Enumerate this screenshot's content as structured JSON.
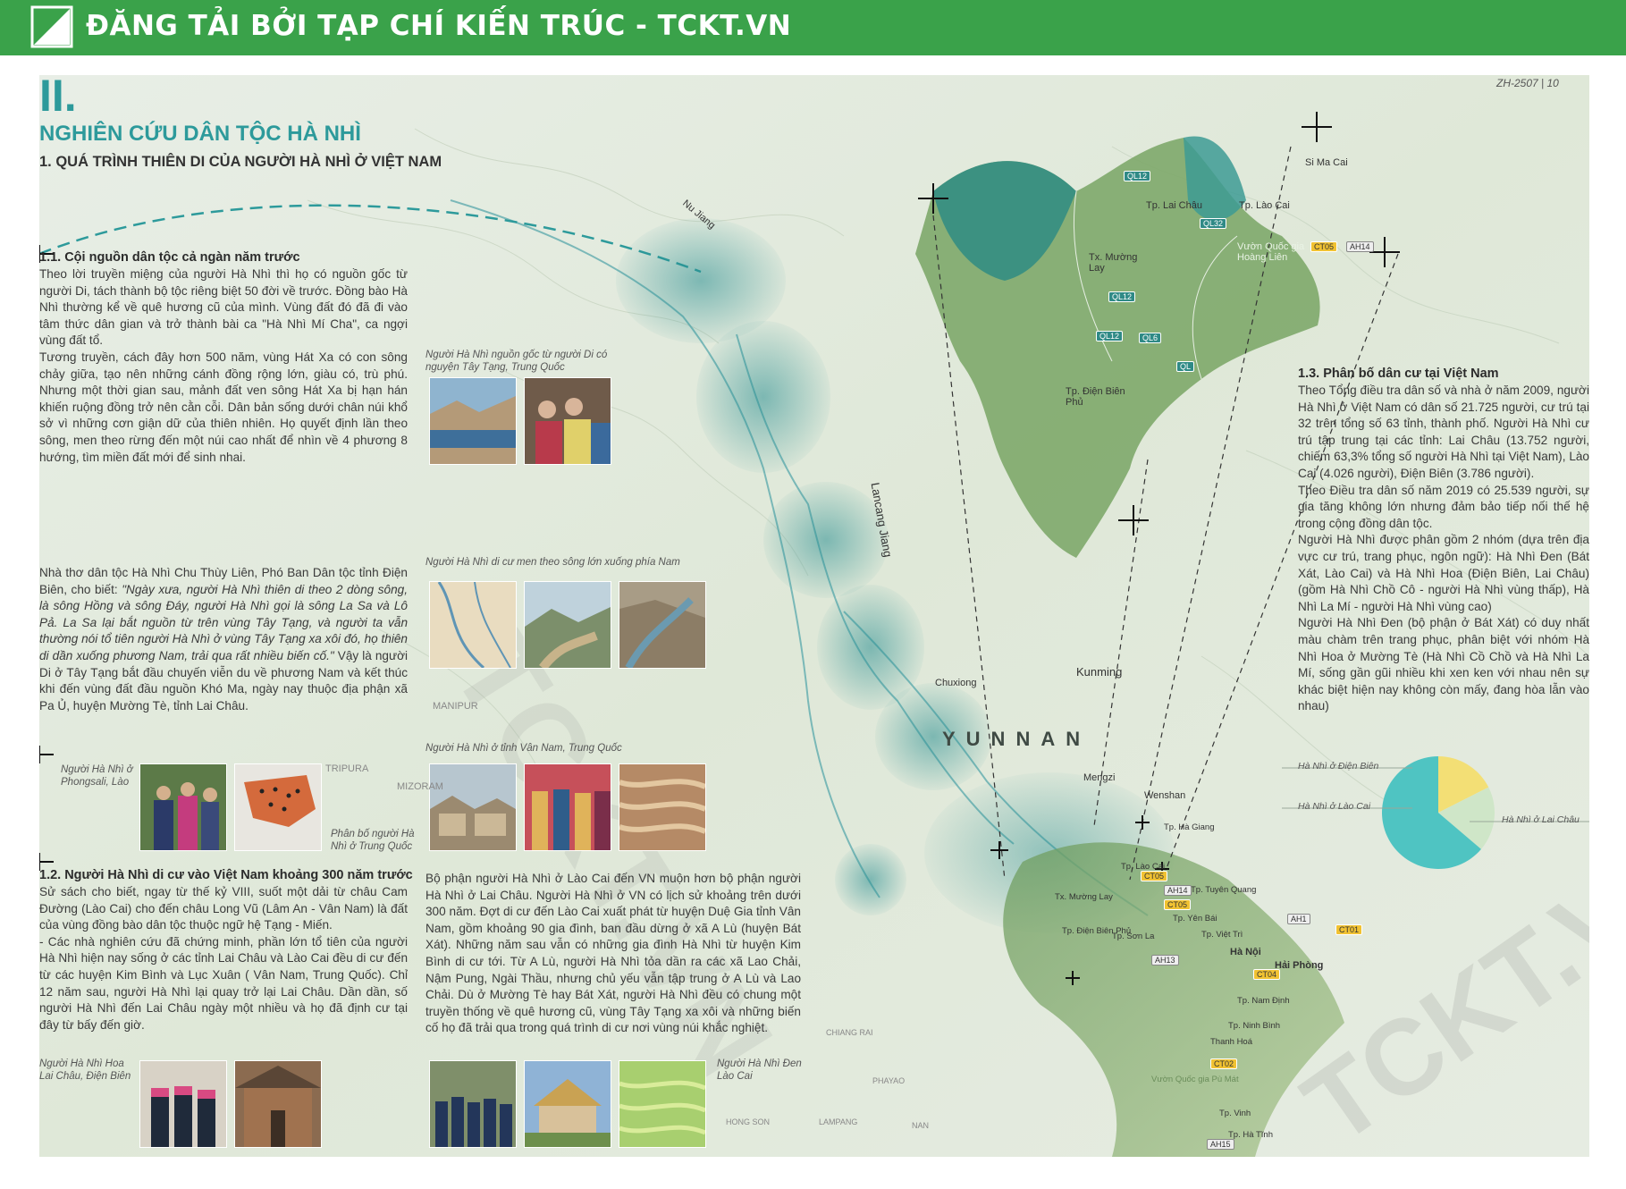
{
  "banner": {
    "title": "ĐĂNG TẢI BỞI TẠP CHÍ KIẾN TRÚC - TCKT.VN",
    "color": "#3aa24a"
  },
  "page_code": "ZH-2507 | 10",
  "section": {
    "number": "II.",
    "title": "NGHIÊN CỨU DÂN TỘC HÀ NHÌ",
    "subtitle": "1. QUÁ TRÌNH THIÊN DI CỦA NGƯỜI HÀ NHÌ Ở VIỆT NAM"
  },
  "s11": {
    "heading": "1.1. Cội nguồn dân tộc cả ngàn năm trước",
    "para1": "Theo lời truyền miệng của người Hà Nhì thì họ có nguồn gốc từ người Di, tách thành bộ tộc riêng biệt 50 đời về trước. Đồng bào Hà Nhì thường kể về quê hương cũ của mình. Vùng đất đó đã đi vào tâm thức dân gian và trở thành bài ca \"Hà Nhì Mí Cha\", ca ngợi vùng đất tổ.",
    "para2": "Tương truyền, cách đây hơn 500 năm, vùng Hát Xa có con sông chảy giữa, tạo nên những cánh đồng rộng lớn, giàu có, trù phú. Nhưng một thời gian sau, mảnh đất ven sông Hát Xa bị hạn hán khiến ruộng đồng trở nên cằn cỗi. Dân bản sống dưới chân núi khổ sở vì những cơn giận dữ của thiên nhiên. Họ quyết định lần theo sông, men theo rừng đến một núi cao nhất để nhìn về 4 phương 8 hướng, tìm miền đất mới để sinh nhai.",
    "para3a": "Nhà thơ dân tộc Hà Nhì Chu Thùy Liên, Phó Ban Dân tộc tỉnh Điện Biên, cho biết: ",
    "para3quote": "\"Ngày xưa, người Hà Nhì thiên di theo 2 dòng sông, là sông Hồng và sông Đáy, người Hà Nhì gọi là sông La Sa và Lô Pả. La Sa lại bắt nguồn từ trên vùng Tây Tạng, và người ta vẫn thường nói tổ tiên người Hà Nhì ở vùng Tây Tạng xa xôi đó, họ thiên di dần xuống phương Nam, trải qua rất nhiều biến cố.\"",
    "para3b": "Vậy là người Di ở Tây Tạng bắt đầu chuyến viễn du về phương Nam và kết thúc khi đến vùng đất đầu nguồn Khó Ma, ngày nay thuộc địa phận xã Pa Ủ, huyện Mường Tè, tỉnh Lai Châu."
  },
  "s12": {
    "heading": "1.2. Người Hà Nhì di cư vào Việt Nam khoảng 300 năm trước",
    "para1": "Sử sách cho biết, ngay từ thế kỷ VIII, suốt một dải từ châu Cam Đường (Lào Cai) cho đến châu Long Vũ (Lâm An - Vân Nam) là đất của vùng đồng bào dân tộc thuộc ngữ hệ Tạng - Miến.",
    "para2": "- Các nhà nghiên cứu đã chứng minh, phần lớn tổ tiên của người Hà Nhì hiện nay sống ở các tỉnh Lai Châu và Lào Cai đều di cư đến từ các huyện Kim Bình và Lục Xuân ( Vân Nam, Trung Quốc). Chỉ 12 năm sau, người Hà Nhì lại quay trở lại Lai Châu. Dần dần, số người Hà Nhì đến Lai Châu ngày một nhiều và họ đã định cư tại đây từ bấy đến giờ.",
    "para3": "Bộ phận người Hà Nhì ở Lào Cai đến VN muộn hơn bộ phận người Hà Nhì ở Lai Châu. Người Hà Nhì ở VN có lịch sử khoảng trên dưới 300 năm. Đợt di cư đến Lào Cai xuất phát từ huyện Duệ Gia tỉnh Vân Nam, gồm khoảng 90 gia đình, ban đầu dừng ở xã A Lù (huyện Bát Xát). Những năm sau vẫn có những gia đình Hà Nhì từ huyện Kim Bình di cư tới. Từ A Lù, người Hà Nhì tỏa dần ra các xã Lao Chải, Nậm Pung, Ngài Thầu, nhưng chủ yếu vẫn tập trung ở A Lù và Lao Chải. Dù ở Mường Tè hay Bát Xát, người Hà Nhì đều có chung một truyền thống về quê hương cũ, vùng Tây Tạng xa xôi và những biến cố họ đã trải qua trong quá trình di cư nơi vùng núi khắc nghiệt."
  },
  "s13": {
    "heading": "1.3. Phân bố dân cư tại Việt Nam",
    "para1": "Theo Tổng điều tra dân số và nhà ở năm 2009, người Hà Nhì ở Việt Nam có dân số 21.725 người, cư trú tại 32 trên tổng số 63 tỉnh, thành phố. Người Hà Nhì cư trú tập trung tại các tỉnh: Lai Châu (13.752 người, chiếm 63,3% tổng số người Hà Nhì tại Việt Nam), Lào Cai (4.026 người), Điện Biên (3.786 người).",
    "para2": "Theo Điều tra dân số năm 2019 có 25.539 người, sự gia tăng không lớn nhưng đảm bảo tiếp nối thế hệ trong cộng đồng dân tộc.",
    "para3": "Người Hà Nhì được phân gồm 2 nhóm (dựa trên địa vực cư trú, trang phục, ngôn ngữ): Hà Nhì Đen (Bát Xát, Lào Cai) và Hà Nhì Hoa (Điện Biên, Lai Châu) (gồm Hà Nhì Chồ Cô - người Hà Nhì vùng thấp), Hà Nhì La Mí - người Hà Nhì vùng cao)",
    "para4": "Người Hà Nhì Đen (bộ phận ở Bát Xát) có duy nhất màu chàm trên trang phục, phân biệt với nhóm Hà Nhì Hoa ở Mường Tè (Hà Nhì Cồ Chồ và Hà Nhì La Mí, sống gần gũi nhiều khi xen ken với nhau nên sự khác biệt hiện nay không còn mấy, đang hòa lẫn vào nhau)"
  },
  "captions": {
    "tibet": "Người Hà Nhì nguồn gốc từ người Di có nguyện Tây Tạng, Trung Quốc",
    "river": "Người Hà Nhì di cư men theo sông lớn xuống phía Nam",
    "laos": "Người Hà Nhì ở Phongsali, Lào",
    "china_part": "Phân bố người Hà Nhì ở Trung Quốc",
    "yunnan": "Người Hà Nhì ở tỉnh Vân Nam, Trung Quốc",
    "hoa": "Người Hà Nhì Hoa Lai Châu, Điện Biên",
    "den": "Người Hà Nhì Đen Lào Cai"
  },
  "pie": {
    "legend": [
      "Hà Nhì ở Điện Biên",
      "Hà Nhì ở Lào Cai",
      "Hà Nhì ở Lai Châu"
    ],
    "values": [
      3786,
      4026,
      13752
    ],
    "colors": [
      "#f3df75",
      "#cfe6c8",
      "#4fc4c2"
    ]
  },
  "map_labels": {
    "si_ma_cai": "Si Ma Cai",
    "lai_chau": "Tp. Lai Châu",
    "lao_cai": "Tp. Lào Cai",
    "muong_lay": "Tx. Mường Lay",
    "vqg": "Vườn Quốc gia Hoàng Liên",
    "dien_bien": "Tp. Điện Biên Phủ",
    "nu_jiang": "Nu Jiang",
    "lancang": "Lancang Jiang",
    "yunnan": "YUNNAN",
    "kunming": "Kunming",
    "manipur": "MANIPUR",
    "mizoram": "MIZORAM",
    "tripura": "TRIPURA",
    "chuxiong": "Chuxiong",
    "wenshan": "Wenshan",
    "mengzi": "Mengzi",
    "ha_noi": "Hà Nội",
    "hai_phong": "Hải Phòng",
    "nam_dinh": "Tp. Nam Định",
    "ninh_binh": "Tp. Ninh Bình",
    "thanh_hoa": "Thanh Hoá",
    "vinh": "Tp. Vinh",
    "ha_tinh": "Tp. Hà Tĩnh",
    "ha_giang": "Tp. Hà Giang",
    "tuyen_quang": "Tp. Tuyên Quang",
    "yen_bai": "Tp. Yên Bái",
    "viet_tri": "Tp. Việt Trì",
    "son_la": "Tp. Sơn La",
    "lao_cai_small": "Tp. Lào Cai",
    "muong_lay_small": "Tx. Mường Lay",
    "dien_bien_small": "Tp. Điện Biên Phủ",
    "vuon_quoc": "Vườn Quốc gia Pù Mát",
    "chiang_rai": "CHIANG RAI",
    "phayao": "PHAYAO",
    "lampang": "LAMPANG",
    "nan": "NAN",
    "hong_son": "HONG SON"
  },
  "roads": {
    "ql12a": "QL12",
    "ql32": "QL32",
    "ql12b": "QL12",
    "ql12c": "QL12",
    "ql6": "QL6",
    "ql": "QL",
    "ct05": "CT05",
    "ah14": "AH14",
    "ct05b": "CT05",
    "ah14b": "AH14",
    "ct05c": "CT05",
    "ah1": "AH1",
    "ct04": "CT04",
    "ct01": "CT01",
    "ct02": "CT02",
    "ah13": "AH13",
    "ah15": "AH15"
  },
  "watermarks": [
    "TCKT.VN",
    "TCKT.VN"
  ],
  "colors": {
    "accent_teal": "#2d9a9b",
    "green_banner": "#3aa24a",
    "dark_green": "#2f6e5a"
  }
}
